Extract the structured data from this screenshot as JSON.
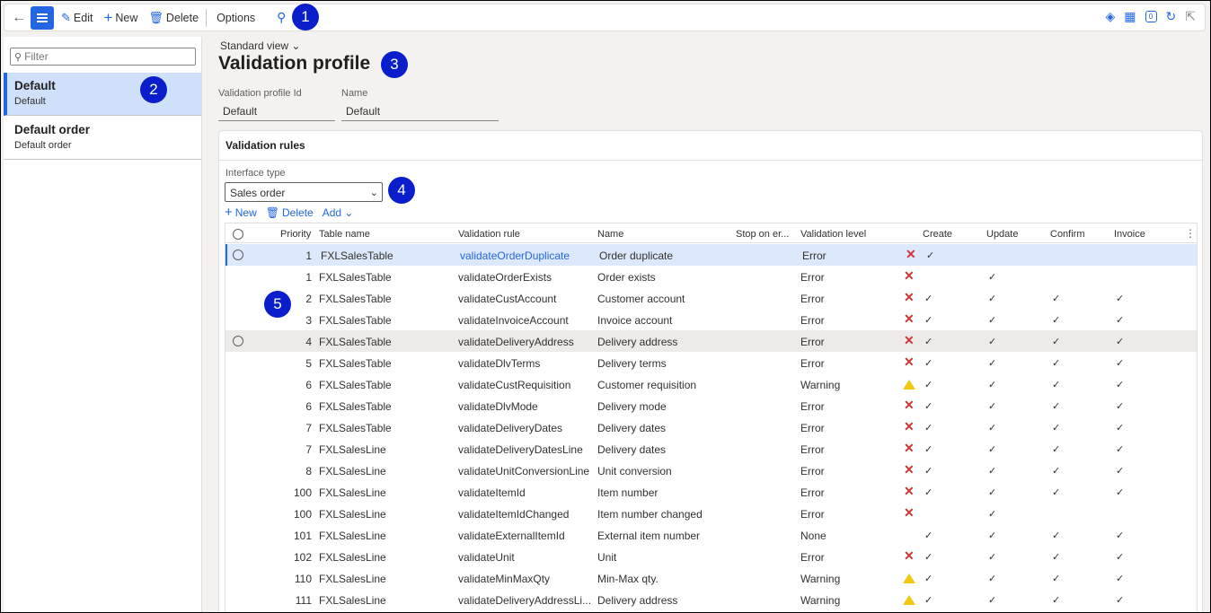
{
  "toolbar": {
    "edit": "Edit",
    "new": "New",
    "delete": "Delete",
    "options": "Options",
    "badge_count": "0"
  },
  "callouts": [
    "1",
    "2",
    "3",
    "4",
    "5"
  ],
  "filter": {
    "placeholder": "Filter"
  },
  "profiles": [
    {
      "title": "Default",
      "subtitle": "Default",
      "selected": true
    },
    {
      "title": "Default order",
      "subtitle": "Default order",
      "selected": false
    }
  ],
  "main": {
    "view": "Standard view",
    "title": "Validation profile",
    "id_label": "Validation profile Id",
    "id_value": "Default",
    "name_label": "Name",
    "name_value": "Default"
  },
  "rules": {
    "section_title": "Validation rules",
    "interface_label": "Interface type",
    "interface_value": "Sales order",
    "actions": {
      "new": "New",
      "delete": "Delete",
      "add": "Add"
    },
    "columns": {
      "priority": "Priority",
      "table": "Table name",
      "rule": "Validation rule",
      "name": "Name",
      "stop": "Stop on er...",
      "level": "Validation level",
      "create": "Create",
      "update": "Update",
      "confirm": "Confirm",
      "invoice": "Invoice"
    },
    "rows": [
      {
        "priority": "1",
        "table": "FXLSalesTable",
        "rule": "validateOrderDuplicate",
        "name": "Order duplicate",
        "level": "Error",
        "status": "error",
        "create": true,
        "update": false,
        "confirm": false,
        "invoice": false
      },
      {
        "priority": "1",
        "table": "FXLSalesTable",
        "rule": "validateOrderExists",
        "name": "Order exists",
        "level": "Error",
        "status": "error",
        "create": false,
        "update": true,
        "confirm": false,
        "invoice": false
      },
      {
        "priority": "2",
        "table": "FXLSalesTable",
        "rule": "validateCustAccount",
        "name": "Customer account",
        "level": "Error",
        "status": "error",
        "create": true,
        "update": true,
        "confirm": true,
        "invoice": true
      },
      {
        "priority": "3",
        "table": "FXLSalesTable",
        "rule": "validateInvoiceAccount",
        "name": "Invoice account",
        "level": "Error",
        "status": "error",
        "create": true,
        "update": true,
        "confirm": true,
        "invoice": true
      },
      {
        "priority": "4",
        "table": "FXLSalesTable",
        "rule": "validateDeliveryAddress",
        "name": "Delivery address",
        "level": "Error",
        "status": "error",
        "create": true,
        "update": true,
        "confirm": true,
        "invoice": true
      },
      {
        "priority": "5",
        "table": "FXLSalesTable",
        "rule": "validateDlvTerms",
        "name": "Delivery terms",
        "level": "Error",
        "status": "error",
        "create": true,
        "update": true,
        "confirm": true,
        "invoice": true
      },
      {
        "priority": "6",
        "table": "FXLSalesTable",
        "rule": "validateCustRequisition",
        "name": "Customer requisition",
        "level": "Warning",
        "status": "warning",
        "create": true,
        "update": true,
        "confirm": true,
        "invoice": true
      },
      {
        "priority": "6",
        "table": "FXLSalesTable",
        "rule": "validateDlvMode",
        "name": "Delivery mode",
        "level": "Error",
        "status": "error",
        "create": true,
        "update": true,
        "confirm": true,
        "invoice": true
      },
      {
        "priority": "7",
        "table": "FXLSalesTable",
        "rule": "validateDeliveryDates",
        "name": "Delivery dates",
        "level": "Error",
        "status": "error",
        "create": true,
        "update": true,
        "confirm": true,
        "invoice": true
      },
      {
        "priority": "7",
        "table": "FXLSalesLine",
        "rule": "validateDeliveryDatesLine",
        "name": "Delivery dates",
        "level": "Error",
        "status": "error",
        "create": true,
        "update": true,
        "confirm": true,
        "invoice": true
      },
      {
        "priority": "8",
        "table": "FXLSalesLine",
        "rule": "validateUnitConversionLine",
        "name": "Unit conversion",
        "level": "Error",
        "status": "error",
        "create": true,
        "update": true,
        "confirm": true,
        "invoice": true
      },
      {
        "priority": "100",
        "table": "FXLSalesLine",
        "rule": "validateItemId",
        "name": "Item number",
        "level": "Error",
        "status": "error",
        "create": true,
        "update": true,
        "confirm": true,
        "invoice": true
      },
      {
        "priority": "100",
        "table": "FXLSalesLine",
        "rule": "validateItemIdChanged",
        "name": "Item number changed",
        "level": "Error",
        "status": "error",
        "create": false,
        "update": true,
        "confirm": false,
        "invoice": false
      },
      {
        "priority": "101",
        "table": "FXLSalesLine",
        "rule": "validateExternalItemId",
        "name": "External item number",
        "level": "None",
        "status": "none",
        "create": true,
        "update": true,
        "confirm": true,
        "invoice": true
      },
      {
        "priority": "102",
        "table": "FXLSalesLine",
        "rule": "validateUnit",
        "name": "Unit",
        "level": "Error",
        "status": "error",
        "create": true,
        "update": true,
        "confirm": true,
        "invoice": true
      },
      {
        "priority": "110",
        "table": "FXLSalesLine",
        "rule": "validateMinMaxQty",
        "name": "Min-Max qty.",
        "level": "Warning",
        "status": "warning",
        "create": true,
        "update": true,
        "confirm": true,
        "invoice": true
      },
      {
        "priority": "111",
        "table": "FXLSalesLine",
        "rule": "validateDeliveryAddressLi...",
        "name": "Delivery address",
        "level": "Warning",
        "status": "warning",
        "create": true,
        "update": true,
        "confirm": true,
        "invoice": true
      }
    ]
  }
}
